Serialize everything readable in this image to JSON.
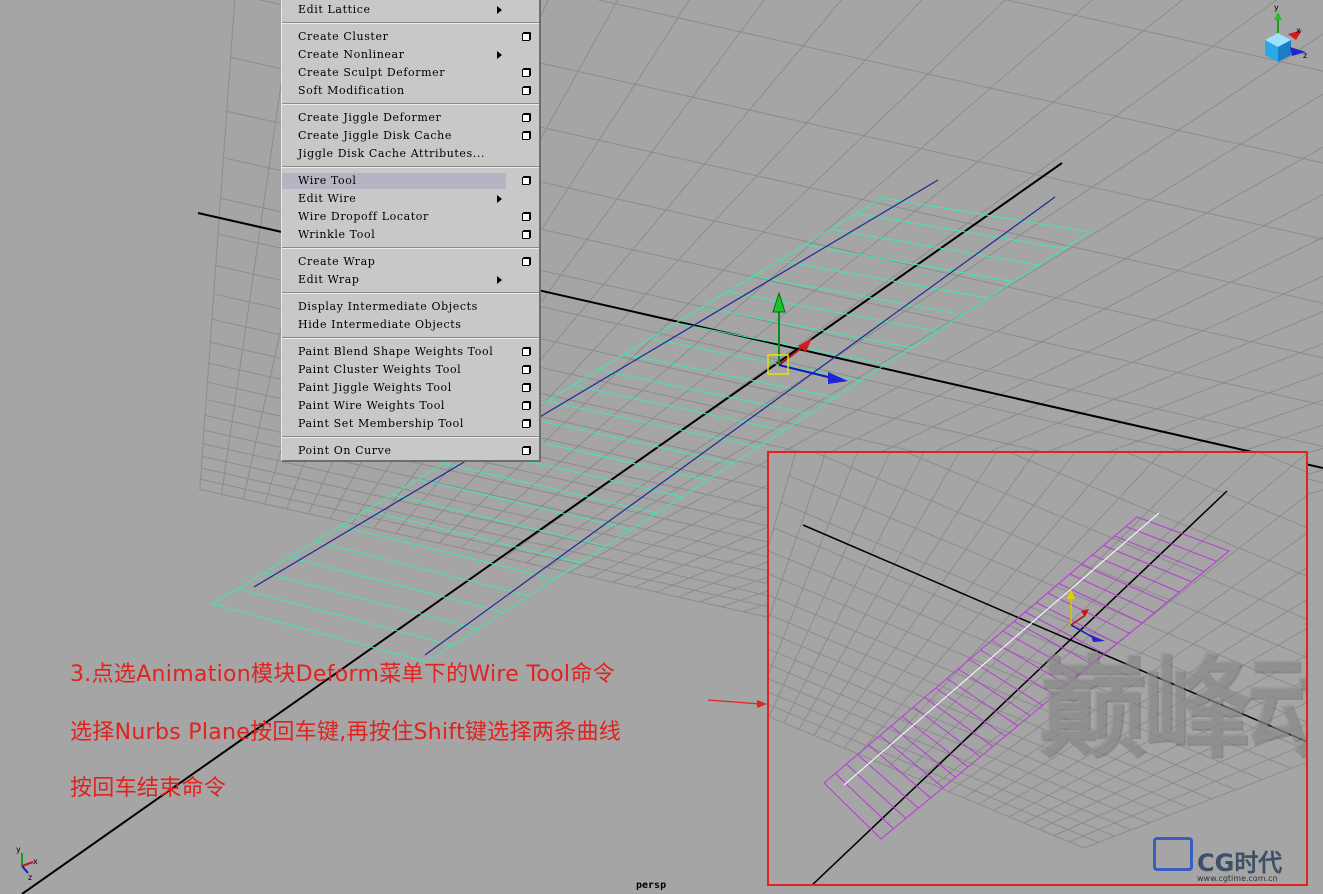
{
  "menu": {
    "items": [
      {
        "label": "Edit Lattice",
        "submenu": true,
        "option": false
      },
      {
        "label": "Create Cluster",
        "submenu": false,
        "option": true
      },
      {
        "label": "Create Nonlinear",
        "submenu": true,
        "option": false
      },
      {
        "label": "Create Sculpt Deformer",
        "submenu": false,
        "option": true
      },
      {
        "label": "Soft Modification",
        "submenu": false,
        "option": true
      },
      {
        "label": "Create Jiggle Deformer",
        "submenu": false,
        "option": true
      },
      {
        "label": "Create Jiggle Disk Cache",
        "submenu": false,
        "option": true
      },
      {
        "label": "Jiggle Disk Cache Attributes...",
        "submenu": false,
        "option": false
      },
      {
        "label": "Wire Tool",
        "submenu": false,
        "option": true,
        "highlighted": true
      },
      {
        "label": "Edit Wire",
        "submenu": true,
        "option": false
      },
      {
        "label": "Wire Dropoff Locator",
        "submenu": false,
        "option": true
      },
      {
        "label": "Wrinkle Tool",
        "submenu": false,
        "option": true
      },
      {
        "label": "Create Wrap",
        "submenu": false,
        "option": true
      },
      {
        "label": "Edit Wrap",
        "submenu": true,
        "option": false
      },
      {
        "label": "Display Intermediate Objects",
        "submenu": false,
        "option": false
      },
      {
        "label": "Hide Intermediate Objects",
        "submenu": false,
        "option": false
      },
      {
        "label": "Paint Blend Shape Weights Tool",
        "submenu": false,
        "option": true
      },
      {
        "label": "Paint Cluster Weights Tool",
        "submenu": false,
        "option": true
      },
      {
        "label": "Paint Jiggle Weights Tool",
        "submenu": false,
        "option": true
      },
      {
        "label": "Paint Wire Weights Tool",
        "submenu": false,
        "option": true
      },
      {
        "label": "Paint Set Membership Tool",
        "submenu": false,
        "option": true
      },
      {
        "label": "Point On Curve",
        "submenu": false,
        "option": true
      }
    ]
  },
  "instructions": {
    "line1": "3.点选Animation模块Deform菜单下的Wire Tool命令",
    "line2": "选择Nurbs Plane按回车键,再按住Shift键选择两条曲线",
    "line3": "按回车结束命令"
  },
  "viewport": {
    "camera_label": "persp",
    "axis_x": "x",
    "axis_y": "y",
    "axis_z": "z"
  },
  "watermark": {
    "studio_text": "巅峰动画",
    "site_logo": "CG时代",
    "site_url": "www.cgtime.com.cn"
  },
  "colors": {
    "background": "#a5a5a5",
    "grid": "#8c8c8c",
    "nurbs_plane": "#3fe8b0",
    "wire_curve": "#1b2a9a",
    "inset_plane": "#b83ad8",
    "annotation": "#e0231f",
    "menu_bg": "#c8c8c8",
    "menu_highlight": "#b7b3c2"
  }
}
